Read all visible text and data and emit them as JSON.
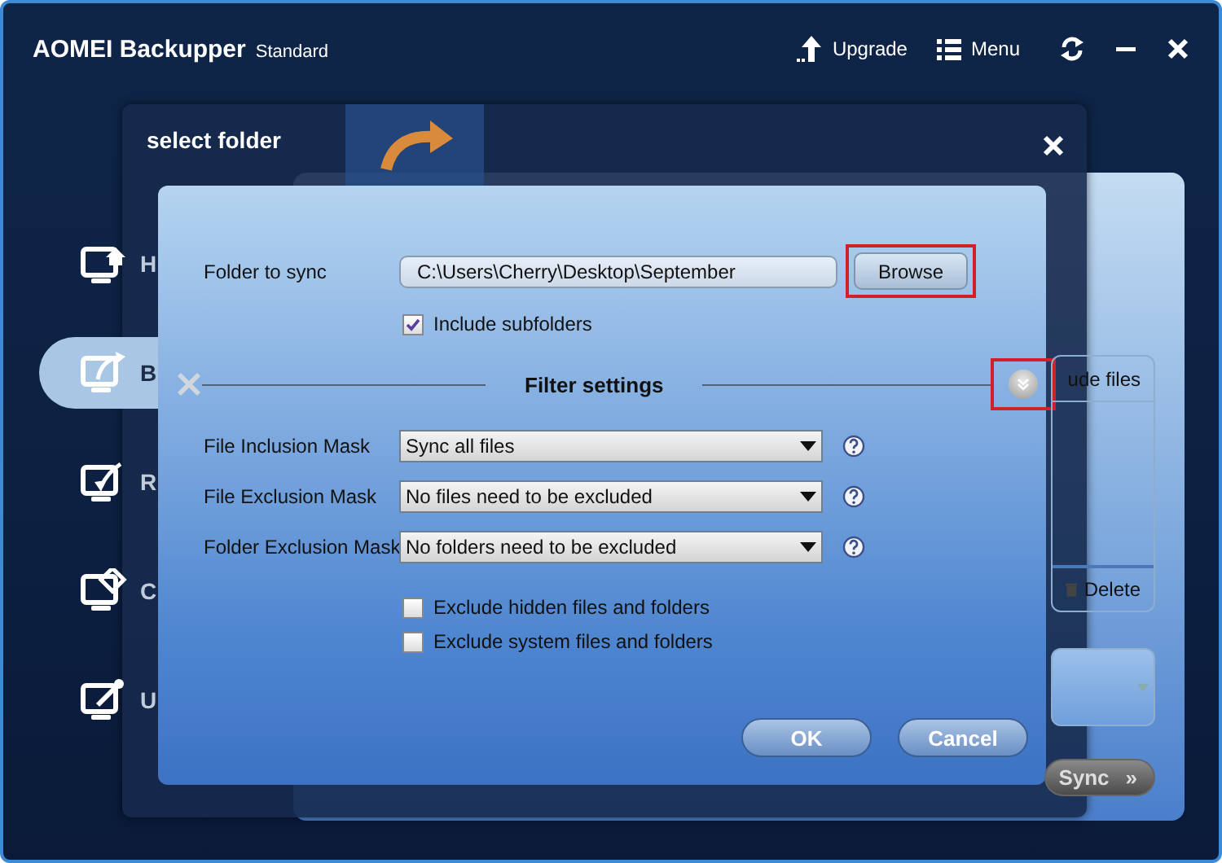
{
  "window": {
    "title": "AOMEI Backupper",
    "edition": "Standard"
  },
  "toolbar": [
    {
      "kind": "upgrade",
      "label": "Upgrade"
    },
    {
      "kind": "menu",
      "label": "Menu"
    }
  ],
  "sidebar": {
    "items": [
      {
        "label": "H",
        "selected": false
      },
      {
        "label": "B",
        "selected": true
      },
      {
        "label": "R",
        "selected": false
      },
      {
        "label": "C",
        "selected": false
      },
      {
        "label": "U",
        "selected": false
      }
    ]
  },
  "background_panel": {
    "list_header": "ude files",
    "delete_label": "Delete",
    "next_button": {
      "label": "Sync",
      "glyph": "»"
    }
  },
  "dialog": {
    "title": "select folder",
    "folder_label": "Folder to sync",
    "folder_path": "C:\\Users\\Cherry\\Desktop\\September",
    "browse_button": {
      "label": "Browse",
      "highlighted": true
    },
    "include_subfolders": {
      "label": "Include subfolders",
      "checked": true
    },
    "filter": {
      "title": "Filter settings",
      "expand_highlighted": true
    },
    "masks": [
      {
        "label": "File Inclusion Mask",
        "value": "Sync all files"
      },
      {
        "label": "File Exclusion Mask",
        "value": "No files need to be excluded"
      },
      {
        "label": "Folder Exclusion Mask",
        "value": "No folders need to be excluded"
      }
    ],
    "options": [
      {
        "label": "Exclude hidden files and folders",
        "checked": false
      },
      {
        "label": "Exclude system files and folders",
        "checked": false
      }
    ],
    "buttons": [
      {
        "label": "OK"
      },
      {
        "label": "Cancel"
      }
    ]
  }
}
